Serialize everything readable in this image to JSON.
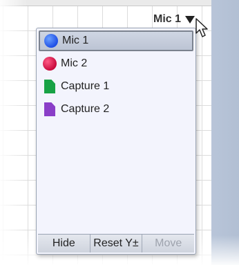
{
  "selector": {
    "label": "Mic 1"
  },
  "menu": {
    "items": [
      {
        "label": "Mic 1",
        "icon": "blue-circle-icon",
        "selected": true
      },
      {
        "label": "Mic 2",
        "icon": "red-circle-icon"
      },
      {
        "label": "Capture 1",
        "icon": "green-document-icon"
      },
      {
        "label": "Capture 2",
        "icon": "purple-document-icon"
      }
    ]
  },
  "footer": {
    "hide_label": "Hide",
    "reset_label": "Reset Y±",
    "move_label": "Move"
  },
  "colors": {
    "track": "#b8c5d9",
    "menu_bg": "#f3f4fd",
    "mic1": "#1f4fe6",
    "mic2": "#c80a3c",
    "capture1": "#18a245",
    "capture2": "#8a3ec8"
  }
}
